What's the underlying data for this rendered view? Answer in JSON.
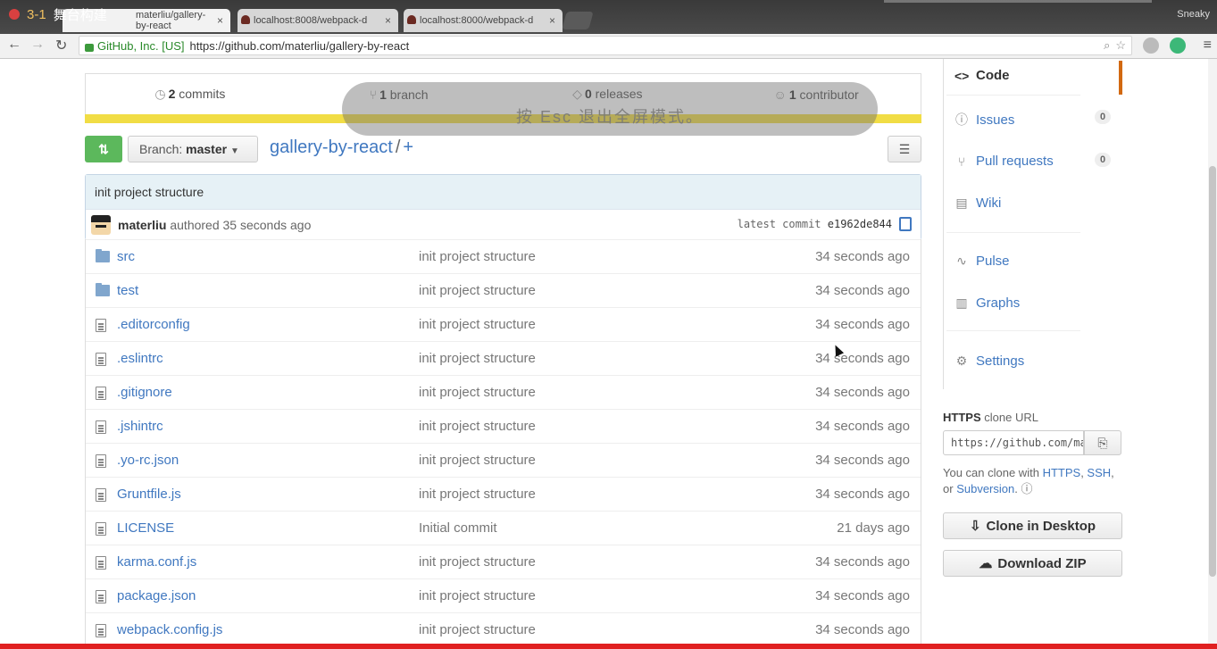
{
  "video": {
    "number": "3-1",
    "title": "舞台构建"
  },
  "browser": {
    "tabs": [
      {
        "label": "materliu/gallery-by-react"
      },
      {
        "label": "localhost:8008/webpack-d"
      },
      {
        "label": "localhost:8000/webpack-d"
      }
    ],
    "profile": "Sneaky",
    "ev_label": "GitHub, Inc. [US]",
    "url": "https://github.com/materliu/gallery-by-react"
  },
  "overlay": {
    "text": "按 Esc 退出全屏模式。"
  },
  "stats": {
    "commits_count": "2",
    "commits_label": "commits",
    "branch_count": "1",
    "branch_label": "branch",
    "releases_count": "0",
    "releases_label": "releases",
    "contrib_count": "1",
    "contrib_label": "contributor"
  },
  "repo": {
    "branch_prefix": "Branch:",
    "branch": "master",
    "name": "gallery-by-react",
    "sep": "/",
    "plus": "+"
  },
  "commit": {
    "message": "init project structure",
    "author": "materliu",
    "authored": "authored 35 seconds ago",
    "latest_label": "latest commit",
    "sha": "e1962de844"
  },
  "files": [
    {
      "type": "folder",
      "name": "src",
      "msg": "init project structure",
      "age": "34 seconds ago"
    },
    {
      "type": "folder",
      "name": "test",
      "msg": "init project structure",
      "age": "34 seconds ago"
    },
    {
      "type": "file",
      "name": ".editorconfig",
      "msg": "init project structure",
      "age": "34 seconds ago"
    },
    {
      "type": "file",
      "name": ".eslintrc",
      "msg": "init project structure",
      "age": "34 seconds ago"
    },
    {
      "type": "file",
      "name": ".gitignore",
      "msg": "init project structure",
      "age": "34 seconds ago"
    },
    {
      "type": "file",
      "name": ".jshintrc",
      "msg": "init project structure",
      "age": "34 seconds ago"
    },
    {
      "type": "file",
      "name": ".yo-rc.json",
      "msg": "init project structure",
      "age": "34 seconds ago"
    },
    {
      "type": "file",
      "name": "Gruntfile.js",
      "msg": "init project structure",
      "age": "34 seconds ago"
    },
    {
      "type": "file",
      "name": "LICENSE",
      "msg": "Initial commit",
      "age": "21 days ago"
    },
    {
      "type": "file",
      "name": "karma.conf.js",
      "msg": "init project structure",
      "age": "34 seconds ago"
    },
    {
      "type": "file",
      "name": "package.json",
      "msg": "init project structure",
      "age": "34 seconds ago"
    },
    {
      "type": "file",
      "name": "webpack.config.js",
      "msg": "init project structure",
      "age": "34 seconds ago"
    }
  ],
  "sidebar": {
    "code": "Code",
    "issues": "Issues",
    "issues_count": "0",
    "pulls": "Pull requests",
    "pulls_count": "0",
    "wiki": "Wiki",
    "pulse": "Pulse",
    "graphs": "Graphs",
    "settings": "Settings"
  },
  "clone": {
    "proto": "HTTPS",
    "label": "clone URL",
    "url": "https://github.com/materliu/gallery-by-react.git",
    "help_prefix": "You can clone with",
    "https": "HTTPS",
    "ssh": "SSH",
    "or": "or",
    "subversion": "Subversion",
    "desktop_btn": "Clone in Desktop",
    "zip_btn": "Download ZIP"
  },
  "colors": {
    "accent": "#d26911",
    "link": "#4078c0",
    "lang": "#f1dd45",
    "green": "#5cb85c"
  }
}
